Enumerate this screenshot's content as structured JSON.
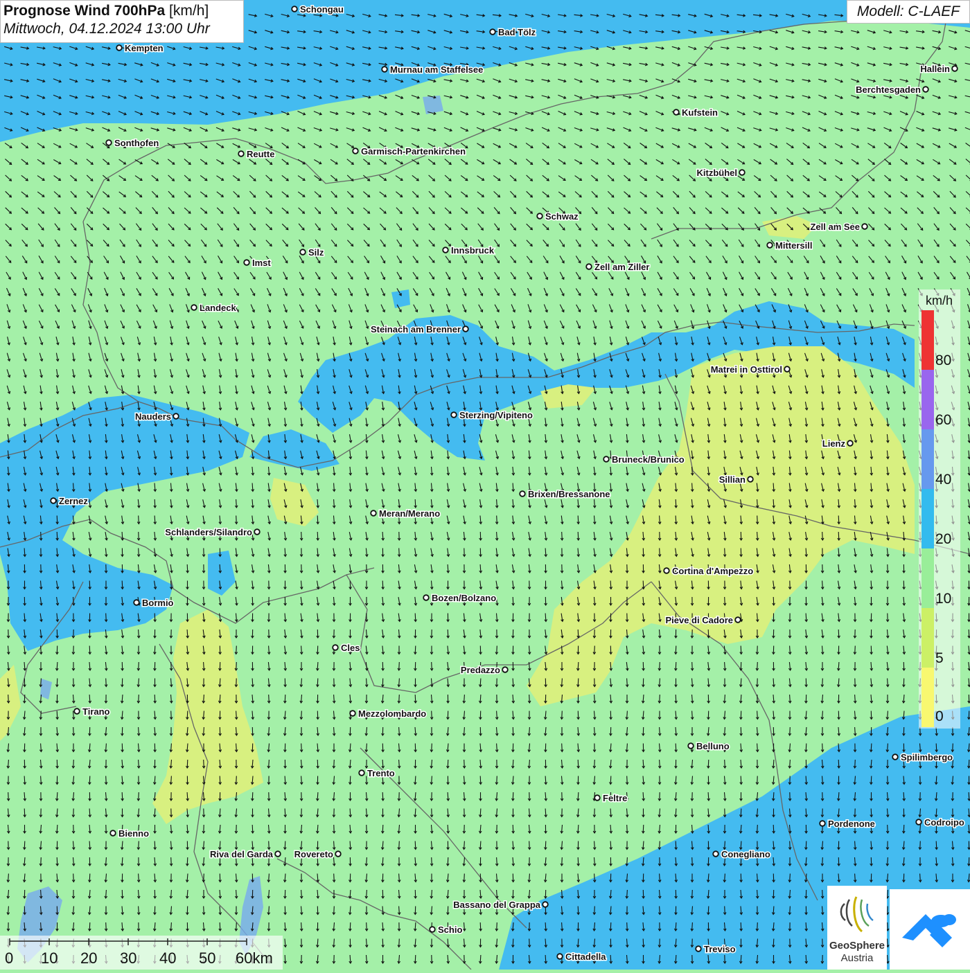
{
  "header": {
    "title_bold": "Prognose Wind 700hPa",
    "title_unit": " [km/h]",
    "datetime": "Mittwoch, 04.12.2024 13:00 Uhr"
  },
  "model": "Modell: C-LAEF",
  "legend": {
    "unit": "km/h",
    "labels": [
      "80",
      "60",
      "40",
      "20",
      "10",
      "5",
      "0"
    ],
    "colors": {
      "above_80": "#ee3333",
      "60_80": "#9966ee",
      "40_60": "#6699ee",
      "20_40": "#33bbee",
      "10_20": "#99ee99",
      "5_10": "#ccf066",
      "0_5": "#f8f870"
    }
  },
  "map_colors": {
    "background_10_20": "#a4f0a8",
    "wind_20_40": "#44bbf0",
    "wind_5_10": "#d8f080",
    "wind_0_5": "#eef080"
  },
  "cities": [
    {
      "name": "Schongau"
    },
    {
      "name": "Bad Tölz"
    },
    {
      "name": "Kempten"
    },
    {
      "name": "Murnau am Staffelsee"
    },
    {
      "name": "Hallein"
    },
    {
      "name": "Berchtesgaden"
    },
    {
      "name": "Kufstein"
    },
    {
      "name": "Sonthofen"
    },
    {
      "name": "Reutte"
    },
    {
      "name": "Garmisch-Partenkirchen"
    },
    {
      "name": "Kitzbühel"
    },
    {
      "name": "Schwaz"
    },
    {
      "name": "Zell am See"
    },
    {
      "name": "Mittersill"
    },
    {
      "name": "Innsbruck"
    },
    {
      "name": "Silz"
    },
    {
      "name": "Imst"
    },
    {
      "name": "Zell am Ziller"
    },
    {
      "name": "Landeck"
    },
    {
      "name": "Steinach am Brenner"
    },
    {
      "name": "Matrei in Osttirol"
    },
    {
      "name": "Nauders"
    },
    {
      "name": "Sterzing/Vipiteno"
    },
    {
      "name": "Lienz"
    },
    {
      "name": "Bruneck/Brunico"
    },
    {
      "name": "Sillian"
    },
    {
      "name": "Zernez"
    },
    {
      "name": "Brixen/Bressanone"
    },
    {
      "name": "Meran/Merano"
    },
    {
      "name": "Schlanders/Silandro"
    },
    {
      "name": "Cortina d'Ampezzo"
    },
    {
      "name": "Bozen/Bolzano"
    },
    {
      "name": "Bormio"
    },
    {
      "name": "Pieve di Cadore"
    },
    {
      "name": "Cles"
    },
    {
      "name": "Predazzo"
    },
    {
      "name": "Tirano"
    },
    {
      "name": "Mezzolombardo"
    },
    {
      "name": "Belluno"
    },
    {
      "name": "Spilimbergo"
    },
    {
      "name": "Trento"
    },
    {
      "name": "Feltre"
    },
    {
      "name": "Pordenone"
    },
    {
      "name": "Codroipo"
    },
    {
      "name": "Bienno"
    },
    {
      "name": "Riva del Garda"
    },
    {
      "name": "Rovereto"
    },
    {
      "name": "Conegliano"
    },
    {
      "name": "Bassano del Grappa"
    },
    {
      "name": "Schio"
    },
    {
      "name": "Treviso"
    },
    {
      "name": "Cittadella"
    }
  ],
  "scale": {
    "labels": [
      "0",
      "10",
      "20",
      "30",
      "40",
      "50",
      "60km"
    ]
  },
  "logos": {
    "geosphere_line1": "GeoSphere",
    "geosphere_line2": "Austria"
  }
}
